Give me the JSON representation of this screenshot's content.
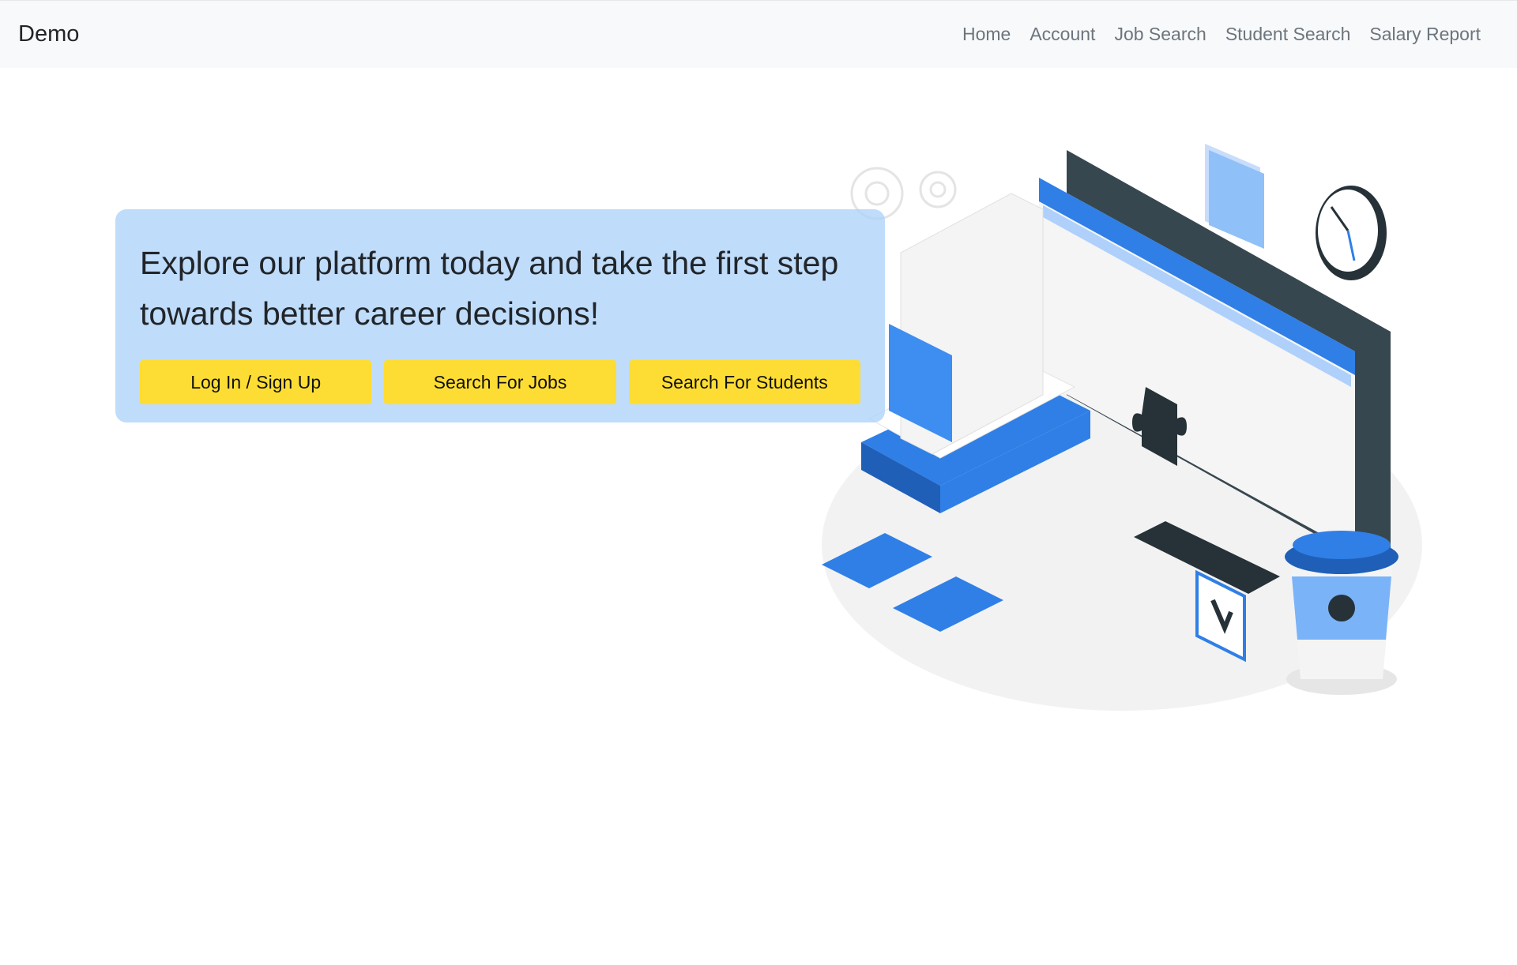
{
  "navbar": {
    "brand": "Demo",
    "links": [
      "Home",
      "Account",
      "Job Search",
      "Student Search",
      "Salary Report"
    ]
  },
  "hero": {
    "headline": "Explore our platform today and take the first step towards better career decisions!",
    "buttons": [
      "Log In / Sign Up",
      "Search For Jobs",
      "Search For Students"
    ]
  },
  "colors": {
    "navbar_bg": "#f8f9fa",
    "hero_bg": "#bcdcfb",
    "button_bg": "#fddd34",
    "accent_blue": "#2f7fe6",
    "dark_slate": "#263238"
  }
}
